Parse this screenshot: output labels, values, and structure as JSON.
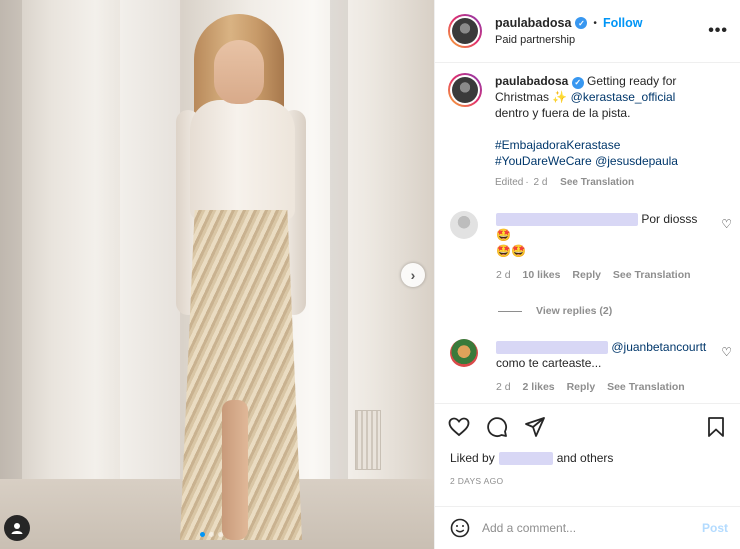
{
  "post": {
    "username": "paulabadosa",
    "follow_label": "Follow",
    "paid_partnership": "Paid partnership",
    "more_icon": "more-options-icon"
  },
  "caption": {
    "username": "paulabadosa",
    "text_1": "Getting ready for Christmas",
    "sparkle": "✨",
    "mention": "@kerastase_official",
    "text_2": "dentro y fuera de la pista.",
    "hashtag_1": "#EmbajadoraKerastase",
    "hashtag_2": "#YouDareWeCare",
    "mention_2": "@jesusdepaula",
    "edited": "Edited",
    "time": "2 d",
    "see_translation": "See Translation"
  },
  "comments": [
    {
      "text": "Por diosss 🤩",
      "emojis": "🤩🤩",
      "time": "2 d",
      "likes": "10 likes",
      "reply": "Reply",
      "translation": "See Translation",
      "view_replies": "View replies (2)"
    },
    {
      "mention": "@juanbetancourtt",
      "text": "como te carteaste...",
      "time": "2 d",
      "likes": "2 likes",
      "reply": "Reply",
      "translation": "See Translation"
    }
  ],
  "likes": {
    "prefix": "Liked by",
    "suffix": "and others"
  },
  "timestamp": "2 DAYS AGO",
  "add_comment": {
    "placeholder": "Add a comment...",
    "post_label": "Post"
  },
  "colors": {
    "accent": "#0095f6",
    "link": "#00376b",
    "muted": "#8e8e8e",
    "redaction": "#d8d7f5"
  }
}
